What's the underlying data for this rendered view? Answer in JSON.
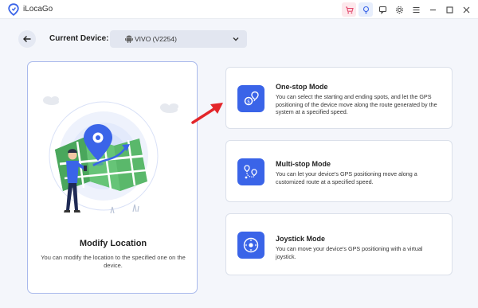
{
  "app": {
    "title": "iLocaGo"
  },
  "window_icons": [
    "cart-icon",
    "tip-icon",
    "feedback-icon",
    "settings-icon",
    "menu-icon",
    "minimize-icon",
    "maximize-icon",
    "close-icon"
  ],
  "toolbar": {
    "device_label": "Current Device:",
    "device_name": "VIVO (V2254)"
  },
  "left_card": {
    "title": "Modify Location",
    "description": "You can modify the location to the specified one on the device."
  },
  "modes": [
    {
      "icon": "route-pin-icon",
      "title": "One-stop Mode",
      "description": "You can select the starting and ending spots, and let the GPS positioning of the device move along the route generated by the system at a specified speed."
    },
    {
      "icon": "multi-pin-icon",
      "title": "Multi-stop Mode",
      "description": "You can let your device's GPS positioning move along a customized route at a specified speed."
    },
    {
      "icon": "joystick-icon",
      "title": "Joystick Mode",
      "description": "You can move your device's GPS positioning with a virtual joystick."
    }
  ],
  "colors": {
    "accent": "#3a64e8",
    "highlight_arrow": "#e3262a",
    "card_border_selected": "#a9b9ec"
  }
}
